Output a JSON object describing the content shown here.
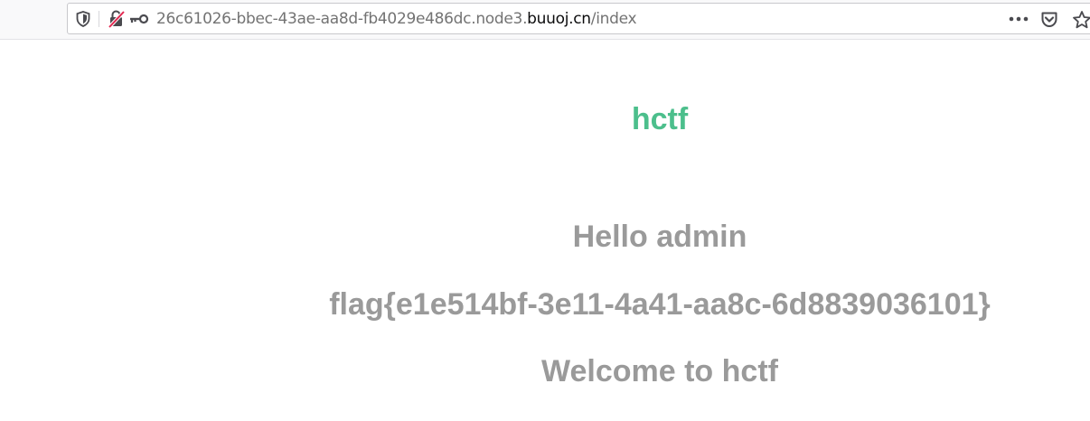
{
  "browser": {
    "url_prefix": "26c61026-bbec-43ae-aa8d-fb4029e486dc.node3.",
    "url_domain": "buuoj.cn",
    "url_path": "/index"
  },
  "page": {
    "site_title": "hctf",
    "hello": "Hello admin",
    "flag": "flag{e1e514bf-3e11-4a41-aa8c-6d8839036101}",
    "welcome": "Welcome to hctf"
  },
  "colors": {
    "title": "#4cbf8c",
    "text": "#9a9a9a"
  }
}
